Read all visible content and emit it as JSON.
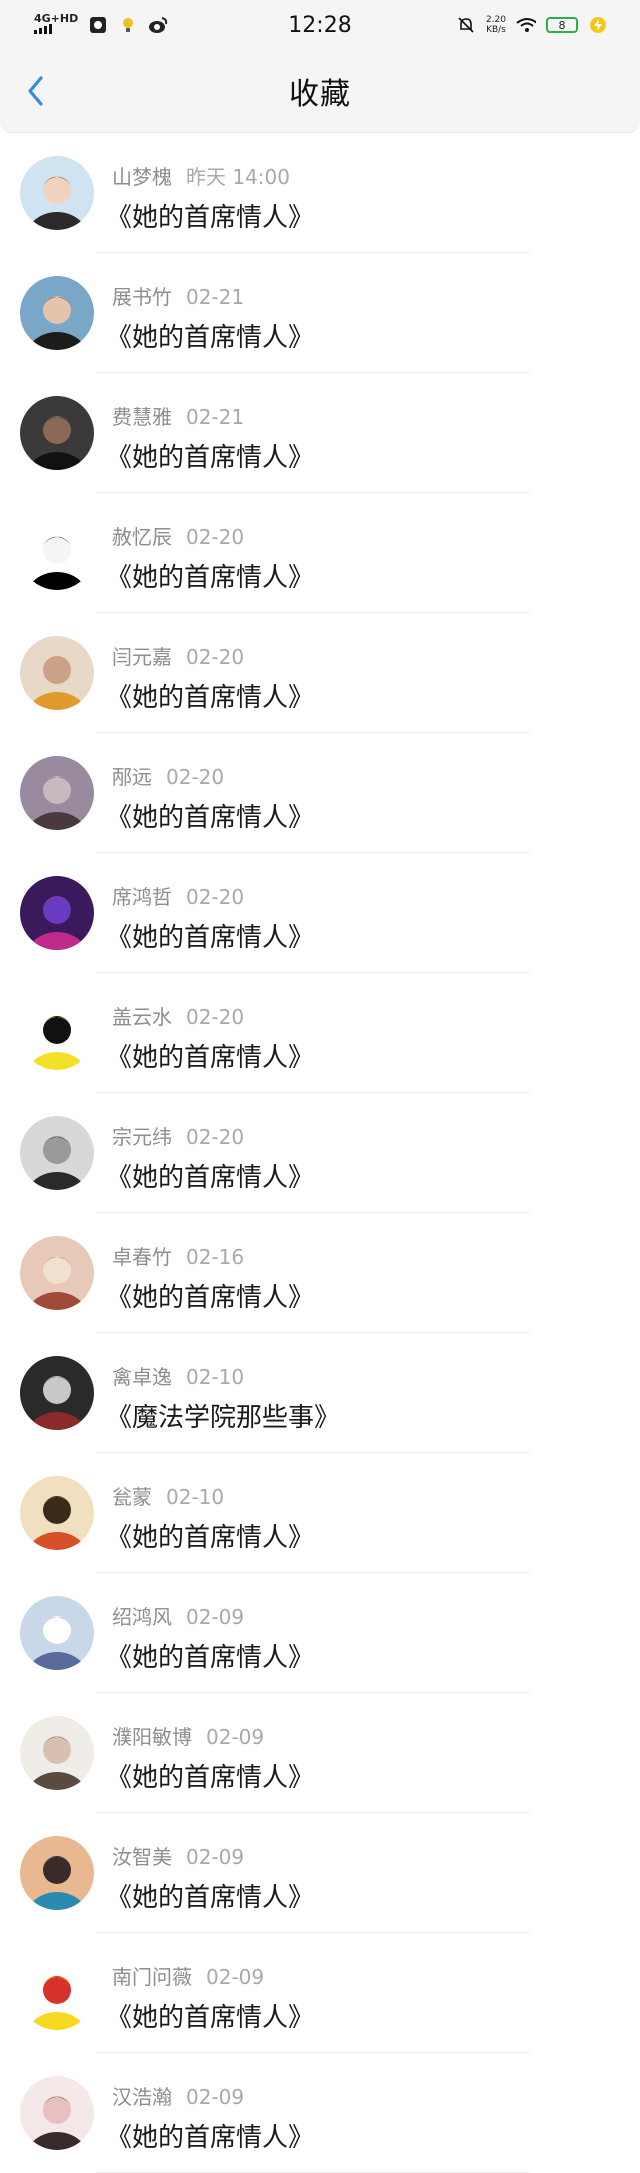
{
  "status_bar": {
    "signal": "4G+HD",
    "time": "12:28",
    "speed_value": "2.20",
    "speed_unit": "KB/s",
    "battery": "8"
  },
  "header": {
    "title": "收藏"
  },
  "favorites": [
    {
      "name": "山梦槐",
      "date": "昨天 14:00",
      "book": "《她的首席情人》",
      "colors": [
        "#cfe3f0",
        "#2a2a2a",
        "#f2d2bd"
      ]
    },
    {
      "name": "展书竹",
      "date": "02-21",
      "book": "《她的首席情人》",
      "colors": [
        "#7aa6c7",
        "#1c1c1c",
        "#e6c3ad"
      ]
    },
    {
      "name": "费慧雅",
      "date": "02-21",
      "book": "《她的首席情人》",
      "colors": [
        "#3a3a3a",
        "#111111",
        "#8a6a55"
      ]
    },
    {
      "name": "赦忆辰",
      "date": "02-20",
      "book": "《她的首席情人》",
      "colors": [
        "#ffffff",
        "#000000",
        "#f5f5f5"
      ]
    },
    {
      "name": "闫元嘉",
      "date": "02-20",
      "book": "《她的首席情人》",
      "colors": [
        "#e8d8c8",
        "#e09a2e",
        "#caa287"
      ]
    },
    {
      "name": "邴远",
      "date": "02-20",
      "book": "《她的首席情人》",
      "colors": [
        "#9a8aa0",
        "#4a3a40",
        "#c8b8c0"
      ]
    },
    {
      "name": "席鸿哲",
      "date": "02-20",
      "book": "《她的首席情人》",
      "colors": [
        "#3a1a5a",
        "#c02a8a",
        "#6a3ac0"
      ]
    },
    {
      "name": "盖云水",
      "date": "02-20",
      "book": "《她的首席情人》",
      "colors": [
        "#ffffff",
        "#f5e028",
        "#111111"
      ]
    },
    {
      "name": "宗元纬",
      "date": "02-20",
      "book": "《她的首席情人》",
      "colors": [
        "#d8d8d8",
        "#2a2a2a",
        "#9a9a9a"
      ]
    },
    {
      "name": "卓春竹",
      "date": "02-16",
      "book": "《她的首席情人》",
      "colors": [
        "#e8c8b8",
        "#a04a3a",
        "#f0e0d0"
      ]
    },
    {
      "name": "禽卓逸",
      "date": "02-10",
      "book": "《魔法学院那些事》",
      "colors": [
        "#2a2a2a",
        "#8a2a2a",
        "#c8c8c8"
      ]
    },
    {
      "name": "瓮蒙",
      "date": "02-10",
      "book": "《她的首席情人》",
      "colors": [
        "#f0e0c0",
        "#d8502a",
        "#3a2a1a"
      ]
    },
    {
      "name": "绍鸿风",
      "date": "02-09",
      "book": "《她的首席情人》",
      "colors": [
        "#c8d8e8",
        "#5a6a9a",
        "#ffffff"
      ]
    },
    {
      "name": "濮阳敏博",
      "date": "02-09",
      "book": "《她的首席情人》",
      "colors": [
        "#f0ece8",
        "#5a4a40",
        "#d8c0b0"
      ]
    },
    {
      "name": "汝智美",
      "date": "02-09",
      "book": "《她的首席情人》",
      "colors": [
        "#e8b890",
        "#2a8ab0",
        "#3a2a2a"
      ]
    },
    {
      "name": "南门问薇",
      "date": "02-09",
      "book": "《她的首席情人》",
      "colors": [
        "#ffffff",
        "#f5d820",
        "#d8302a"
      ]
    },
    {
      "name": "汉浩瀚",
      "date": "02-09",
      "book": "《她的首席情人》",
      "colors": [
        "#f5e8e8",
        "#3a2a2a",
        "#e8c0c0"
      ]
    }
  ]
}
